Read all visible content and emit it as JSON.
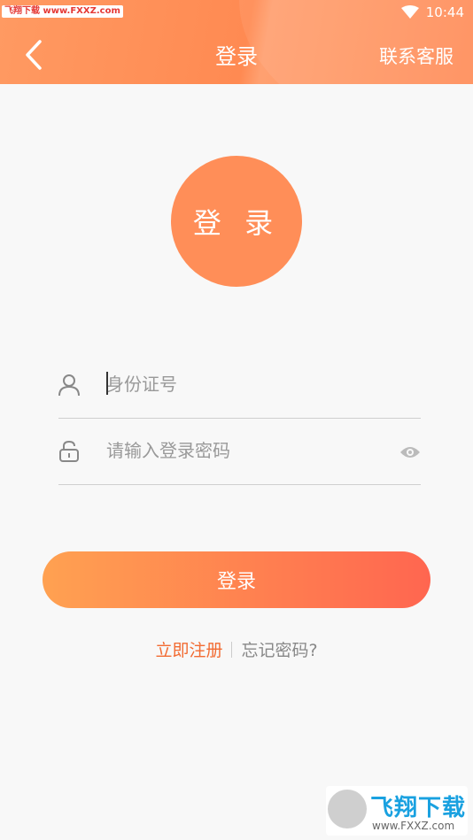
{
  "status_bar": {
    "watermark": "飞翔下载 www.FXXZ.com",
    "time": "10:44"
  },
  "navbar": {
    "title": "登录",
    "contact": "联系客服"
  },
  "avatar": {
    "label": "登 录"
  },
  "form": {
    "id_placeholder": "身份证号",
    "password_placeholder": "请输入登录密码"
  },
  "login_button": "登录",
  "links": {
    "register": "立即注册",
    "forgot": "忘记密码?"
  },
  "brand": {
    "name": "飞翔下载",
    "url": "www.FXXZ.com"
  },
  "colors": {
    "accent": "#ff8e58",
    "button_start": "#ffa151",
    "button_end": "#ff6650",
    "link": "#f26b32"
  }
}
